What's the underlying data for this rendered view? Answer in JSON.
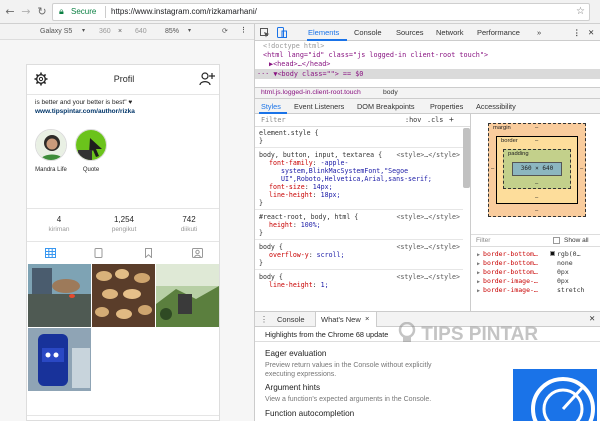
{
  "browser": {
    "secure_label": "Secure",
    "url": "https://www.instagram.com/rizkamarhani/"
  },
  "device_toolbar": {
    "device": "Galaxy S5",
    "width": "360",
    "times": "×",
    "height": "640",
    "zoom": "85%"
  },
  "profile": {
    "title": "Profil",
    "bio_line": "is better and your better is best\" ♥",
    "bio_link": "www.tipspintar.com/author/rizka",
    "highlights": [
      {
        "label": "Mandra Life"
      },
      {
        "label": "Quote"
      }
    ],
    "stats": [
      {
        "value": "4",
        "label": "kiriman"
      },
      {
        "value": "1,254",
        "label": "pengikut"
      },
      {
        "value": "742",
        "label": "diikuti"
      }
    ]
  },
  "devtools": {
    "tabs": [
      "Elements",
      "Console",
      "Sources",
      "Network",
      "Performance",
      "»"
    ],
    "dom_lines": [
      "<!doctype html>",
      "<html lang=\"id\" class=\"js logged-in client-root touch\">",
      "▶<head>…</head>",
      "··· ▼<body class=\"\"> == $0"
    ],
    "breadcrumbs": [
      "html.js.logged-in.client-root.touch",
      "body"
    ],
    "subtabs": [
      "Styles",
      "Event Listeners",
      "DOM Breakpoints",
      "Properties",
      "Accessibility"
    ],
    "filter_placeholder": "Filter",
    "filter_toggles": [
      ":hov",
      ".cls",
      "+"
    ],
    "rules": [
      {
        "selector": "element.style {",
        "source": "",
        "decls": [],
        "close": "}"
      },
      {
        "selector": "body, button, input, textarea {",
        "source": "<style>…</style>",
        "decls": [
          {
            "prop": "font-family",
            "val": "-apple-"
          },
          {
            "prop": "",
            "val": "system,BlinkMacSystemFont,\"Segoe"
          },
          {
            "prop": "",
            "val": "UI\",Roboto,Helvetica,Arial,sans-serif;"
          },
          {
            "prop": "font-size",
            "val": "14px;"
          },
          {
            "prop": "line-height",
            "val": "18px;"
          }
        ],
        "close": "}"
      },
      {
        "selector": "#react-root, body, html {",
        "source": "<style>…</style>",
        "decls": [
          {
            "prop": "height",
            "val": "100%;"
          }
        ],
        "close": "}"
      },
      {
        "selector": "body {",
        "source": "<style>…</style>",
        "decls": [
          {
            "prop": "overflow-y",
            "val": "scroll;"
          }
        ],
        "close": "}"
      },
      {
        "selector": "body {",
        "source": "<style>…</style>",
        "decls": [
          {
            "prop": "line-height",
            "val": "1;"
          }
        ],
        "close": ""
      }
    ],
    "box_model": {
      "margin_label": "margin",
      "border_label": "border",
      "padding_label": "padding",
      "content": "360 × 640",
      "dash": "–"
    },
    "computed_filter": "Filter",
    "show_all": "Show all",
    "computed": [
      {
        "prop": "border-bottom…",
        "val": "rgb(0…"
      },
      {
        "prop": "border-bottom…",
        "val": "none"
      },
      {
        "prop": "border-bottom…",
        "val": "0px"
      },
      {
        "prop": "border-image-…",
        "val": "0px"
      },
      {
        "prop": "border-image-…",
        "val": "stretch"
      }
    ],
    "drawer_tabs": [
      "Console",
      "What's New"
    ],
    "drawer_close": "×",
    "whatsnew": {
      "highlight": "Highlights from the Chrome 68 update",
      "items": [
        {
          "title": "Eager evaluation",
          "body1": "Preview return values in the Console without explicitly",
          "body2": "executing expressions."
        },
        {
          "title": "Argument hints",
          "body1": "View a function's expected arguments in the Console.",
          "body2": ""
        },
        {
          "title": "Function autocompletion",
          "body1": "",
          "body2": ""
        }
      ]
    },
    "watermark": "TIPS PINTAR"
  },
  "colors": {
    "accent": "#1a73e8",
    "secure": "#0b8043",
    "css_prop": "#c80000",
    "css_val": "#1a1aa6",
    "dom_tag": "#881280"
  }
}
